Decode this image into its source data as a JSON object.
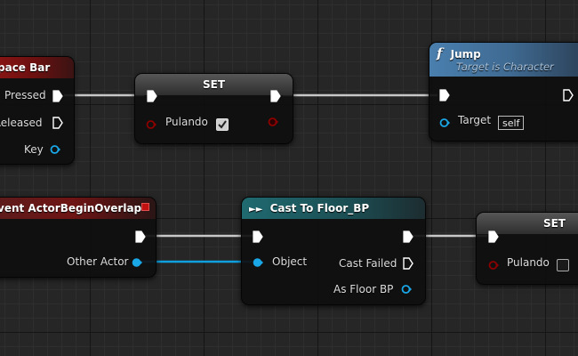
{
  "nodes": {
    "space_bar": {
      "title": "pace Bar",
      "pins": {
        "pressed": "Pressed",
        "released": "Released",
        "key": "Key"
      }
    },
    "set_top": {
      "title": "SET",
      "pins": {
        "pulando": "Pulando"
      },
      "checked": true
    },
    "jump": {
      "function_glyph": "f",
      "title": "Jump",
      "subtitle": "Target is Character",
      "pins": {
        "target": "Target",
        "target_value": "self"
      }
    },
    "begin_overlap": {
      "title": "vent ActorBeginOverlap",
      "pins": {
        "other_actor": "Other Actor"
      }
    },
    "cast": {
      "title": "Cast To Floor_BP",
      "pins": {
        "object": "Object",
        "cast_failed": "Cast Failed",
        "as_floor_bp": "As Floor BP"
      }
    },
    "set_bottom": {
      "title": "SET",
      "pins": {
        "pulando": "Pulando"
      },
      "checked": false
    }
  },
  "colors": {
    "exec_pin": "#ffffff",
    "bool_pin": "#8c0000",
    "object_pin": "#00a8f4",
    "exec_wire": "#ffffff",
    "object_wire": "#0fa0e0",
    "event_header": "#8e1515",
    "cast_header": "#1f6a70",
    "function_header": "#4a7fae"
  }
}
